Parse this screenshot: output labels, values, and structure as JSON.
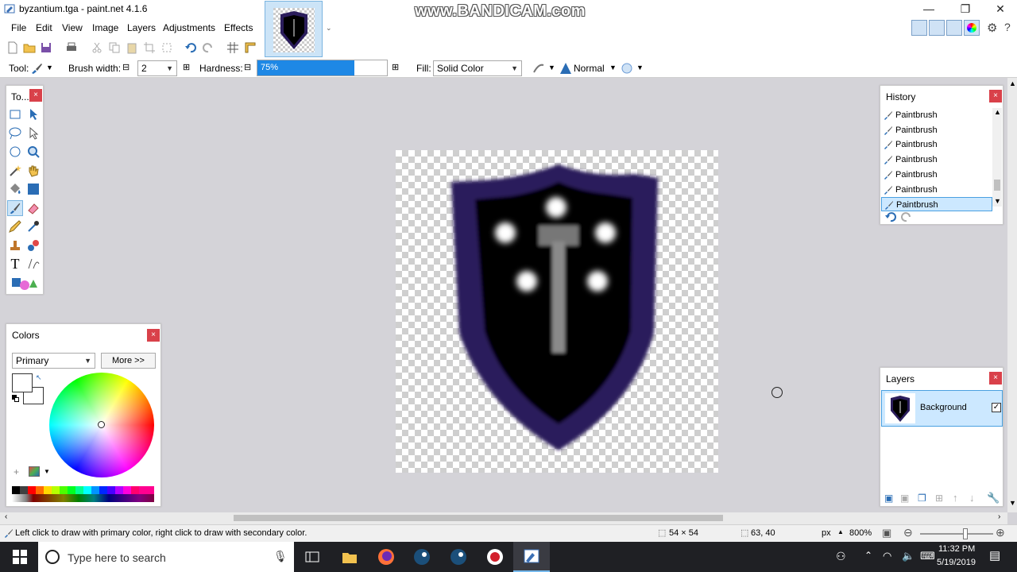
{
  "window": {
    "title": "byzantium.tga - paint.net 4.1.6",
    "watermark": "www.BANDICAM.com"
  },
  "menu": [
    "File",
    "Edit",
    "View",
    "Image",
    "Layers",
    "Adjustments",
    "Effects"
  ],
  "toolbar2": {
    "tool_label": "Tool:",
    "brush_width_label": "Brush width:",
    "brush_width_value": "2",
    "hardness_label": "Hardness:",
    "hardness_value": "75%",
    "hardness_fraction": 0.75,
    "fill_label": "Fill:",
    "fill_value": "Solid Color",
    "blend_value": "Normal"
  },
  "tools_panel": {
    "title": "To..."
  },
  "colors_panel": {
    "title": "Colors",
    "mode": "Primary",
    "more_button": "More >>",
    "primary_color": "#ffffff",
    "secondary_color": "#ffffff"
  },
  "history_panel": {
    "title": "History",
    "items": [
      "Paintbrush",
      "Paintbrush",
      "Paintbrush",
      "Paintbrush",
      "Paintbrush",
      "Paintbrush",
      "Paintbrush"
    ],
    "selected_index": 6
  },
  "layers_panel": {
    "title": "Layers",
    "layers": [
      {
        "name": "Background",
        "visible": true
      }
    ]
  },
  "status": {
    "hint": "Left click to draw with primary color, right click to draw with secondary color.",
    "size": "54 × 54",
    "position": "63, 40",
    "unit": "px",
    "zoom": "800%"
  },
  "taskbar": {
    "search_placeholder": "Type here to search",
    "time": "11:32 PM",
    "date": "5/19/2019"
  },
  "colors": {
    "shield_border": "#2b1d5c",
    "shield_fill": "#000000",
    "accent": "#0078d7"
  }
}
